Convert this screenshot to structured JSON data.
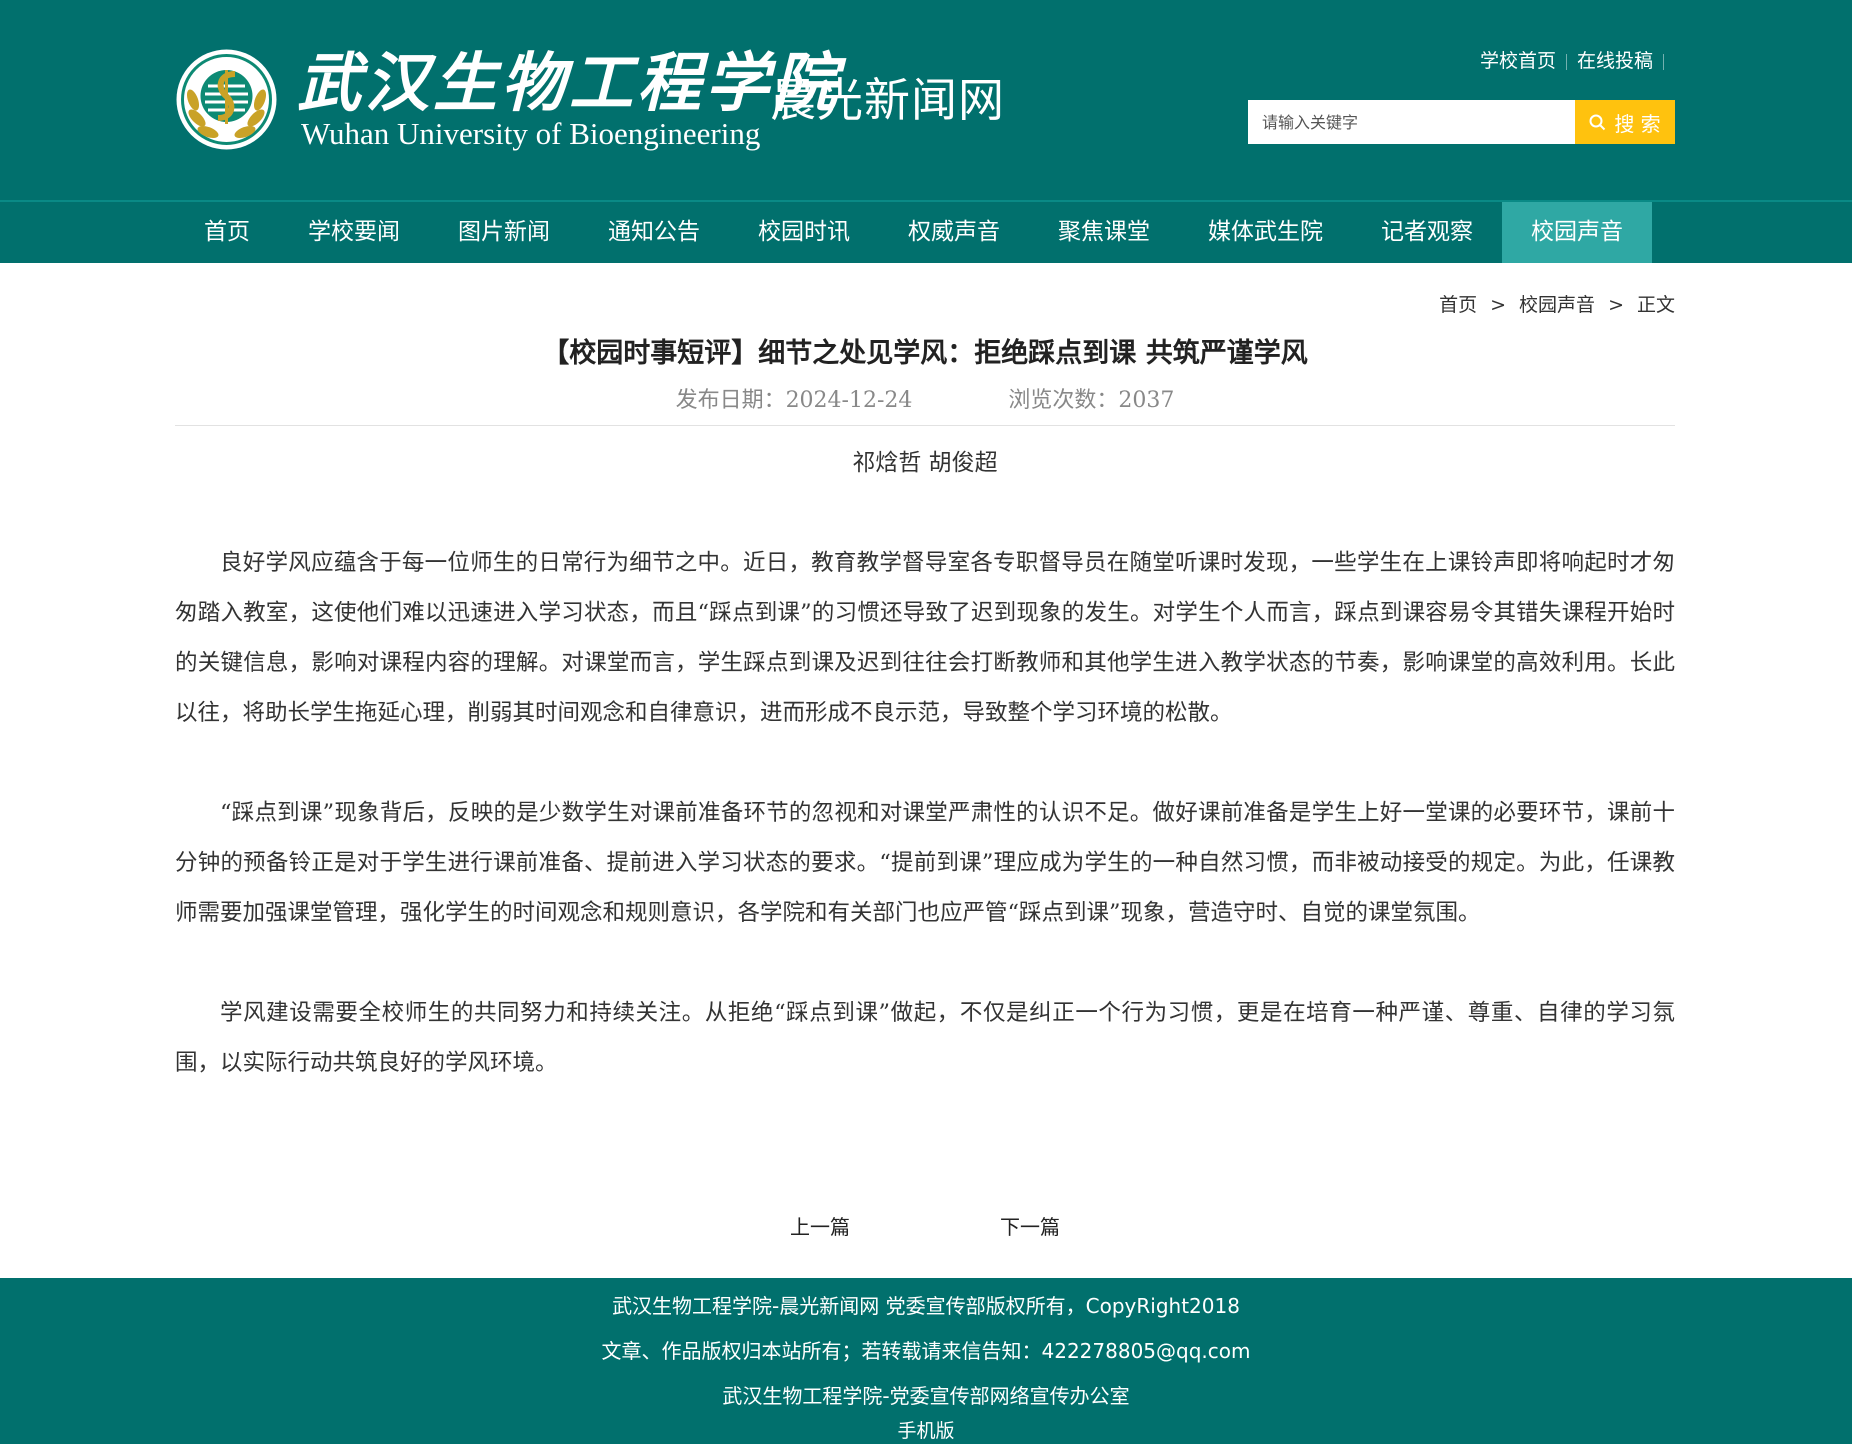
{
  "header": {
    "logo_cn": "武汉生物工程学院",
    "logo_en": "Wuhan University of Bioengineering",
    "site_name": "晨光新闻网",
    "top_links": [
      "学校首页",
      "在线投稿"
    ],
    "search": {
      "placeholder": "请输入关键字",
      "button_label": "搜 索"
    }
  },
  "nav": {
    "items": [
      "首页",
      "学校要闻",
      "图片新闻",
      "通知公告",
      "校园时讯",
      "权威声音",
      "聚焦课堂",
      "媒体武生院",
      "记者观察",
      "校园声音"
    ],
    "active": "校园声音"
  },
  "breadcrumb": {
    "items": [
      "首页",
      "校园声音",
      "正文"
    ],
    "separator": ">"
  },
  "article": {
    "title": "【校园时事短评】细节之处见学风：拒绝踩点到课 共筑严谨学风",
    "date_label": "发布日期：2024-12-24",
    "views_label": "浏览次数：2037",
    "authors": "祁焓哲  胡俊超",
    "paragraphs": [
      "良好学风应蕴含于每一位师生的日常行为细节之中。近日，教育教学督导室各专职督导员在随堂听课时发现，一些学生在上课铃声即将响起时才匆匆踏入教室，这使他们难以迅速进入学习状态，而且“踩点到课”的习惯还导致了迟到现象的发生。对学生个人而言，踩点到课容易令其错失课程开始时的关键信息，影响对课程内容的理解。对课堂而言，学生踩点到课及迟到往往会打断教师和其他学生进入教学状态的节奏，影响课堂的高效利用。长此以往，将助长学生拖延心理，削弱其时间观念和自律意识，进而形成不良示范，导致整个学习环境的松散。",
      "“踩点到课”现象背后，反映的是少数学生对课前准备环节的忽视和对课堂严肃性的认识不足。做好课前准备是学生上好一堂课的必要环节，课前十分钟的预备铃正是对于学生进行课前准备、提前进入学习状态的要求。“提前到课”理应成为学生的一种自然习惯，而非被动接受的规定。为此，任课教师需要加强课堂管理，强化学生的时间观念和规则意识，各学院和有关部门也应严管“踩点到课”现象，营造守时、自觉的课堂氛围。",
      "学风建设需要全校师生的共同努力和持续关注。从拒绝“踩点到课”做起，不仅是纠正一个行为习惯，更是在培育一种严谨、尊重、自律的学习氛围，以实际行动共筑良好的学风环境。"
    ],
    "prev_label": "上一篇",
    "next_label": "下一篇"
  },
  "footer": {
    "line1": "武汉生物工程学院-晨光新闻网 党委宣传部版权所有，CopyRight2018",
    "line2": "文章、作品版权归本站所有；若转载请来信告知：422278805@qq.com",
    "line3": "武汉生物工程学院-党委宣传部网络宣传办公室",
    "mobile_label": "手机版"
  },
  "colors": {
    "primary": "#01706d",
    "nav_active": "#2fa8a4",
    "search_button": "#ffc20e"
  },
  "icons": {
    "emblem": "university-emblem-icon",
    "search": "search-icon"
  }
}
